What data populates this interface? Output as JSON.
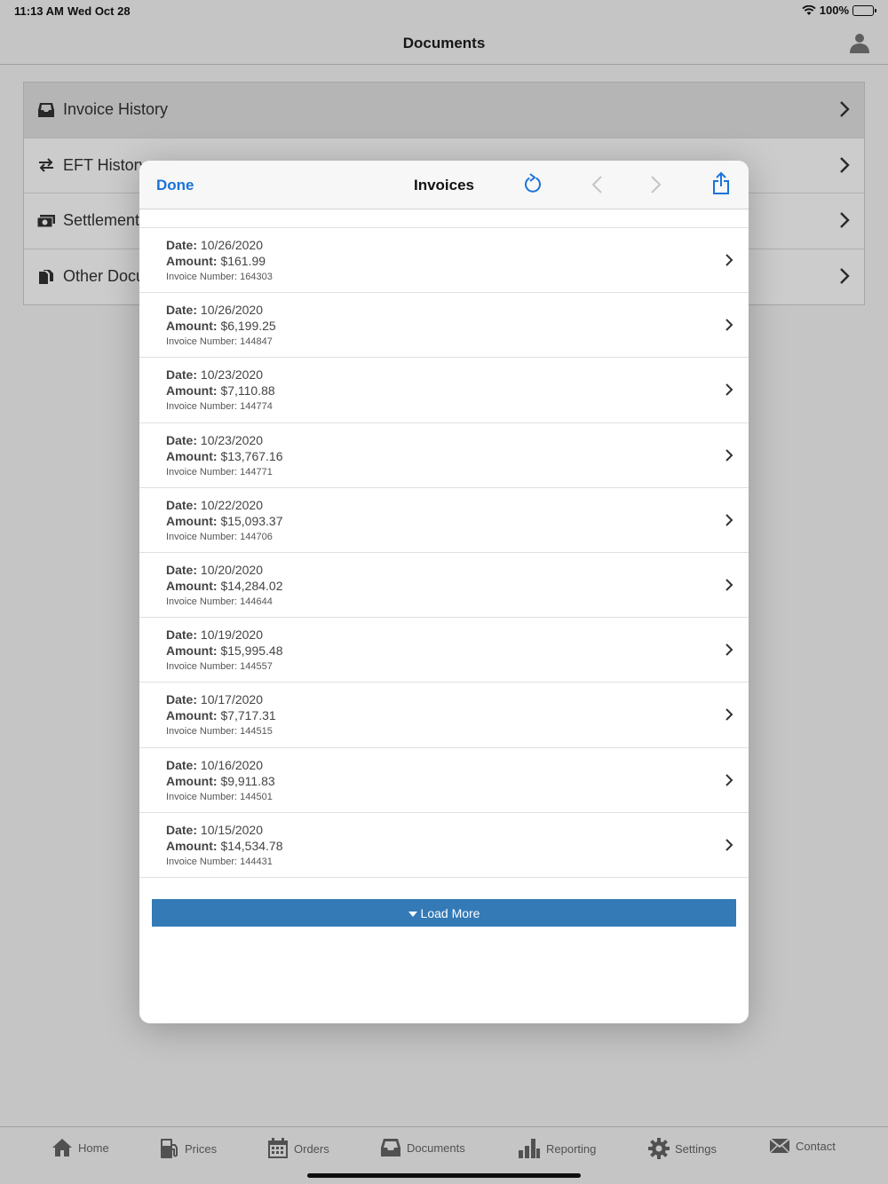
{
  "status": {
    "time": "11:13 AM",
    "date": "Wed Oct 28",
    "battery": "100%"
  },
  "nav": {
    "title": "Documents"
  },
  "documents": [
    {
      "label": "Invoice History",
      "icon": "inbox-icon"
    },
    {
      "label": "EFT History",
      "icon": "transfer-arrows-icon"
    },
    {
      "label": "Settlement",
      "icon": "money-icon"
    },
    {
      "label": "Other Docu",
      "icon": "files-icon"
    }
  ],
  "modal": {
    "done": "Done",
    "title": "Invoices",
    "load_more": "Load More",
    "invoices": [
      {
        "date_label": "Date:",
        "date": "10/26/2020",
        "amount_label": "Amount:",
        "amount": "$161.99",
        "number": "Invoice Number: 164303"
      },
      {
        "date_label": "Date:",
        "date": "10/26/2020",
        "amount_label": "Amount:",
        "amount": "$6,199.25",
        "number": "Invoice Number: 144847"
      },
      {
        "date_label": "Date:",
        "date": "10/23/2020",
        "amount_label": "Amount:",
        "amount": "$7,110.88",
        "number": "Invoice Number: 144774"
      },
      {
        "date_label": "Date:",
        "date": "10/23/2020",
        "amount_label": "Amount:",
        "amount": "$13,767.16",
        "number": "Invoice Number: 144771"
      },
      {
        "date_label": "Date:",
        "date": "10/22/2020",
        "amount_label": "Amount:",
        "amount": "$15,093.37",
        "number": "Invoice Number: 144706"
      },
      {
        "date_label": "Date:",
        "date": "10/20/2020",
        "amount_label": "Amount:",
        "amount": "$14,284.02",
        "number": "Invoice Number: 144644"
      },
      {
        "date_label": "Date:",
        "date": "10/19/2020",
        "amount_label": "Amount:",
        "amount": "$15,995.48",
        "number": "Invoice Number: 144557"
      },
      {
        "date_label": "Date:",
        "date": "10/17/2020",
        "amount_label": "Amount:",
        "amount": "$7,717.31",
        "number": "Invoice Number: 144515"
      },
      {
        "date_label": "Date:",
        "date": "10/16/2020",
        "amount_label": "Amount:",
        "amount": "$9,911.83",
        "number": "Invoice Number: 144501"
      },
      {
        "date_label": "Date:",
        "date": "10/15/2020",
        "amount_label": "Amount:",
        "amount": "$14,534.78",
        "number": "Invoice Number: 144431"
      }
    ]
  },
  "tabs": [
    {
      "label": "Home",
      "icon": "home-icon"
    },
    {
      "label": "Prices",
      "icon": "fuel-pump-icon"
    },
    {
      "label": "Orders",
      "icon": "calendar-icon"
    },
    {
      "label": "Documents",
      "icon": "inbox-icon"
    },
    {
      "label": "Reporting",
      "icon": "bar-chart-icon"
    },
    {
      "label": "Settings",
      "icon": "gear-icon"
    },
    {
      "label": "Contact",
      "icon": "envelope-icon"
    }
  ],
  "colors": {
    "accent": "#1a73d9",
    "load_more_bg": "#337ab7"
  }
}
